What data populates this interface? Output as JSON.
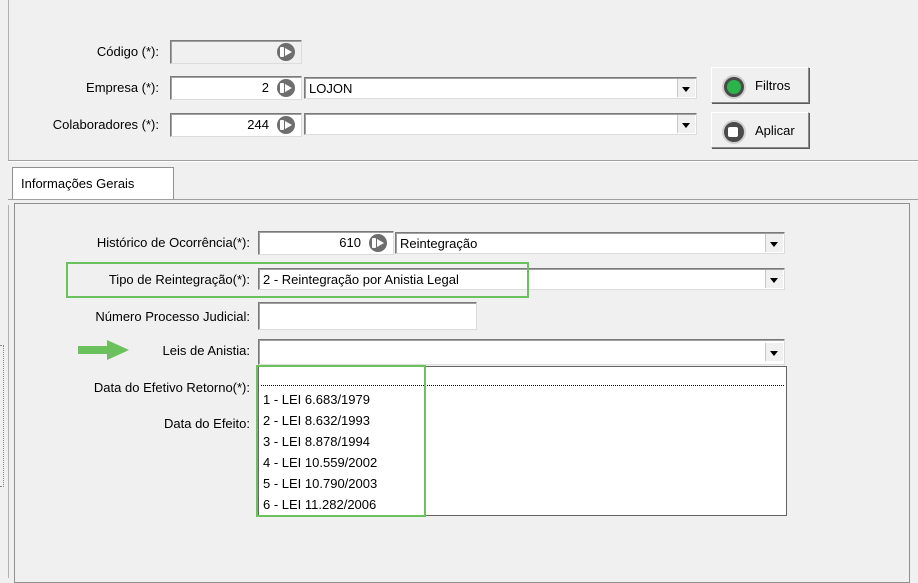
{
  "header": {
    "codigo": {
      "label": "Código (*):",
      "value": ""
    },
    "empresa": {
      "label": "Empresa (*):",
      "code": "2",
      "name": "LOJON"
    },
    "colaboradores": {
      "label": "Colaboradores (*):",
      "code": "244",
      "name": ""
    },
    "buttons": {
      "filtros": {
        "label": "Filtros",
        "icon": "green-circle-icon"
      },
      "aplicar": {
        "label": "Aplicar",
        "icon": "apply-icon"
      }
    }
  },
  "tabs": [
    {
      "label": "Informações Gerais",
      "active": true
    }
  ],
  "form": {
    "historico": {
      "label": "Histórico de Ocorrência(*):",
      "code": "610",
      "name": "Reintegração"
    },
    "tipo": {
      "label": "Tipo de Reintegração(*):",
      "value": "2 - Reintegração por Anistia Legal"
    },
    "numero_processo": {
      "label": "Número Processo Judicial:",
      "value": ""
    },
    "leis": {
      "label": "Leis de Anistia:",
      "value": ""
    },
    "data_retorno": {
      "label": "Data do Efetivo Retorno(*):"
    },
    "data_efeito": {
      "label": "Data do Efeito:"
    }
  },
  "leis_dropdown": {
    "open": true,
    "options": [
      "1 - LEI 6.683/1979",
      "2 - LEI 8.632/1993",
      "3 - LEI 8.878/1994",
      "4 - LEI 10.559/2002",
      "5 - LEI 10.790/2003",
      "6 - LEI 11.282/2006"
    ]
  },
  "colors": {
    "highlight": "#6bc15c",
    "window_bg": "#f0f0f0"
  }
}
